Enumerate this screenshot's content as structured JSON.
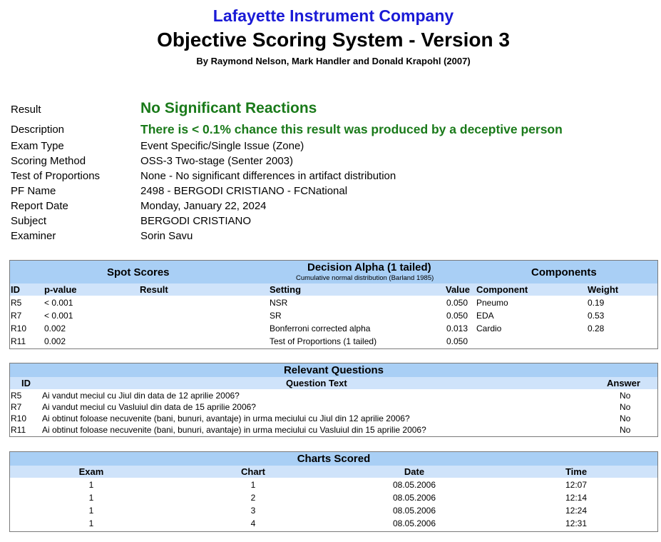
{
  "header": {
    "company": "Lafayette Instrument Company",
    "title": "Objective Scoring System - Version 3",
    "authors": "By Raymond Nelson, Mark Handler and Donald Krapohl (2007)"
  },
  "info": {
    "result_label": "Result",
    "result_value": "No Significant Reactions",
    "description_label": "Description",
    "description_value": "There is < 0.1% chance this result was produced by a deceptive person",
    "exam_type_label": "Exam Type",
    "exam_type_value": "Event Specific/Single Issue (Zone)",
    "scoring_method_label": "Scoring Method",
    "scoring_method_value": "OSS-3 Two-stage (Senter 2003)",
    "test_of_proportions_label": "Test of Proportions",
    "test_of_proportions_value": "None - No significant differences in artifact distribution",
    "pf_name_label": "PF Name",
    "pf_name_value": "2498 - BERGODI CRISTIANO - FCNational",
    "report_date_label": "Report Date",
    "report_date_value": "Monday, January 22, 2024",
    "subject_label": "Subject",
    "subject_value": "BERGODI CRISTIANO",
    "examiner_label": "Examiner",
    "examiner_value": "Sorin Savu"
  },
  "scores": {
    "spot_title": "Spot Scores",
    "alpha_title": "Decision Alpha (1 tailed)",
    "alpha_subtitle": "Cumulative normal distribution (Barland 1985)",
    "components_title": "Components",
    "col_id": "ID",
    "col_pvalue": "p-value",
    "col_result": "Result",
    "col_setting": "Setting",
    "col_value": "Value",
    "col_component": "Component",
    "col_weight": "Weight",
    "rows": [
      {
        "id": "R5",
        "pvalue": "< 0.001",
        "result": "",
        "setting": "NSR",
        "value": "0.050",
        "component": "Pneumo",
        "weight": "0.19"
      },
      {
        "id": "R7",
        "pvalue": "< 0.001",
        "result": "",
        "setting": "SR",
        "value": "0.050",
        "component": "EDA",
        "weight": "0.53"
      },
      {
        "id": "R10",
        "pvalue": "0.002",
        "result": "",
        "setting": "Bonferroni corrected alpha",
        "value": "0.013",
        "component": "Cardio",
        "weight": "0.28"
      },
      {
        "id": "R11",
        "pvalue": "0.002",
        "result": "",
        "setting": "Test of Proportions (1 tailed)",
        "value": "0.050",
        "component": "",
        "weight": ""
      }
    ]
  },
  "questions": {
    "title": "Relevant Questions",
    "col_id": "ID",
    "col_text": "Question Text",
    "col_answer": "Answer",
    "rows": [
      {
        "id": "R5",
        "text": "Ai vandut meciul cu Jiul din data de 12 aprilie 2006?",
        "answer": "No"
      },
      {
        "id": "R7",
        "text": "Ai vandut meciul cu Vasluiul din data de 15 aprilie 2006?",
        "answer": "No"
      },
      {
        "id": "R10",
        "text": "Ai obtinut foloase necuvenite (bani, bunuri, avantaje) in urma meciului cu Jiul din 12 aprilie 2006?",
        "answer": "No"
      },
      {
        "id": "R11",
        "text": "Ai obtinut foloase necuvenite (bani, bunuri, avantaje) in urma meciului cu Vasluiul din 15 aprilie 2006?",
        "answer": "No"
      }
    ]
  },
  "charts": {
    "title": "Charts Scored",
    "col_exam": "Exam",
    "col_chart": "Chart",
    "col_date": "Date",
    "col_time": "Time",
    "rows": [
      {
        "exam": "1",
        "chart": "1",
        "date": "08.05.2006",
        "time": "12:07"
      },
      {
        "exam": "1",
        "chart": "2",
        "date": "08.05.2006",
        "time": "12:14"
      },
      {
        "exam": "1",
        "chart": "3",
        "date": "08.05.2006",
        "time": "12:24"
      },
      {
        "exam": "1",
        "chart": "4",
        "date": "08.05.2006",
        "time": "12:31"
      }
    ]
  },
  "colors": {
    "company_blue": "#1a1ad6",
    "result_green": "#1a7a1a",
    "header_blue": "#a9cff5",
    "subheader_blue": "#cfe3fa"
  }
}
